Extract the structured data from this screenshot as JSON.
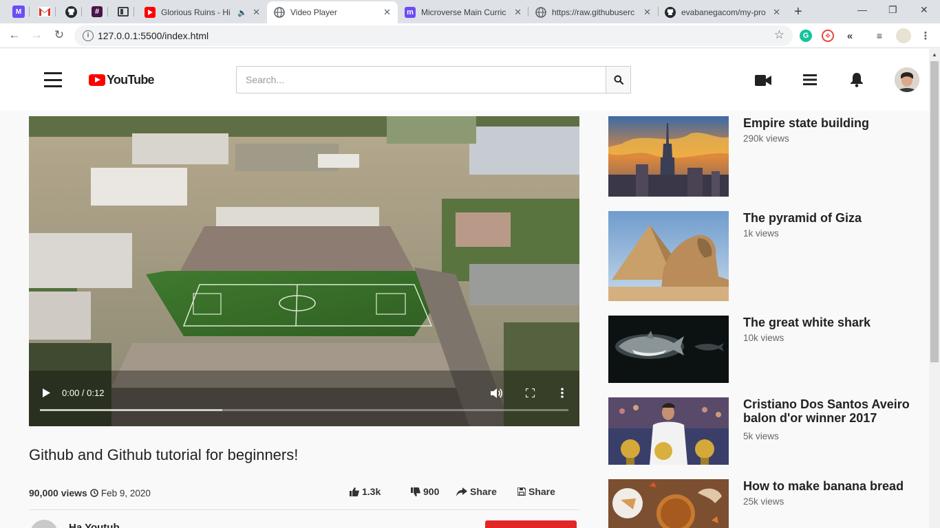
{
  "browser": {
    "tabs": [
      {
        "title": "Glorious Ruins - Hi",
        "active": false
      },
      {
        "title": "Video Player",
        "active": true
      },
      {
        "title": "Microverse Main Curric",
        "active": false
      },
      {
        "title": "https://raw.githubuserc",
        "active": false
      },
      {
        "title": "evabanegacom/my-pro",
        "active": false
      }
    ],
    "url": "127.0.0.1:5500/index.html"
  },
  "header": {
    "logo_text": "YouTube",
    "search_placeholder": "Search..."
  },
  "video": {
    "time": "0:00 / 0:12",
    "progress": 0,
    "title": "Github and Github tutorial for beginners!",
    "views": "90,000 views",
    "date": "Feb 9, 2020",
    "likes": "1.3k",
    "dislikes": "900",
    "share_label": "Share",
    "save_label": "Share"
  },
  "channel": {
    "name": "Ha Youtub",
    "subscribe_label": ""
  },
  "related": [
    {
      "title": "Empire state building",
      "views": "290k views"
    },
    {
      "title": "The pyramid of Giza",
      "views": "1k views"
    },
    {
      "title": "The great white shark",
      "views": "10k views"
    },
    {
      "title": "Cristiano Dos Santos Aveiro balon d'or winner 2017",
      "views": "5k views"
    },
    {
      "title": "How to make banana bread",
      "views": "25k views"
    }
  ],
  "colors": {
    "brand_red": "#ff0000",
    "subscribe_red": "#e32626"
  }
}
